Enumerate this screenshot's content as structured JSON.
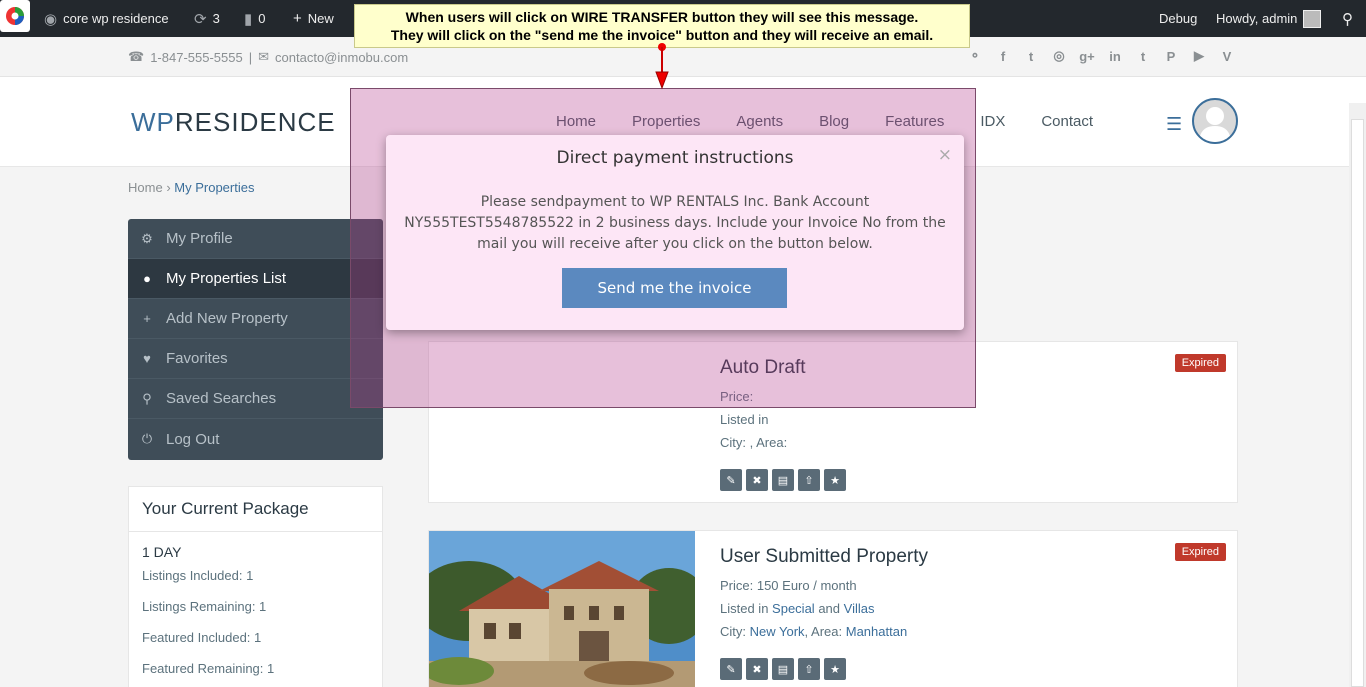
{
  "adminbar": {
    "site_name": "core wp residence",
    "updates_count": "3",
    "comments_count": "0",
    "new_label": "New",
    "debug_label": "Debug",
    "howdy_label": "Howdy, admin"
  },
  "callout": {
    "line1": "When users will click on WIRE TRANSFER button they will see this message.",
    "line2": "They will click on the \"send me the invoice\" button and they will receive an email."
  },
  "topbar": {
    "phone": "1-847-555-5555",
    "separator": "|",
    "email": "contacto@inmobu.com"
  },
  "header": {
    "logo_wp": "WP",
    "logo_rest": "RESIDENCE",
    "nav": [
      "Home",
      "Properties",
      "Agents",
      "Blog",
      "Features",
      "IDX",
      "Contact"
    ]
  },
  "breadcrumb": {
    "home": "Home",
    "sep": "›",
    "current": "My Properties"
  },
  "sidebar": {
    "items": [
      {
        "label": "My Profile",
        "icon": "gear-icon"
      },
      {
        "label": "My Properties List",
        "icon": "map-marker-icon"
      },
      {
        "label": "Add New Property",
        "icon": "plus-icon"
      },
      {
        "label": "Favorites",
        "icon": "heart-icon"
      },
      {
        "label": "Saved Searches",
        "icon": "search-icon"
      },
      {
        "label": "Log Out",
        "icon": "power-icon"
      }
    ]
  },
  "package": {
    "title": "Your Current Package",
    "name": "1 DAY",
    "rows": [
      "Listings Included: 1",
      "Listings Remaining: 1",
      "Featured Included: 1",
      "Featured Remaining: 1"
    ]
  },
  "properties": [
    {
      "title": "Auto Draft",
      "badge": "Expired",
      "price": "Price:",
      "listed": "Listed in",
      "city": "City: , Area:"
    },
    {
      "title": "User Submitted Property",
      "badge": "Expired",
      "price": "Price: 150 Euro / month",
      "listed_prefix": "Listed in",
      "category1": "Special",
      "and": "and",
      "category2": "Villas",
      "city_prefix": "City:",
      "city": "New York",
      "area_prefix": ", Area:",
      "area": "Manhattan"
    }
  ],
  "modal": {
    "title": "Direct payment instructions",
    "close": "×",
    "body": "Please sendpayment to WP RENTALS Inc. Bank Account NY555TEST5548785522 in 2 business days. Include your Invoice No from the mail you will receive after you click on the button below.",
    "button": "Send me the invoice"
  },
  "colors": {
    "accent": "#3b6e9a",
    "badge": "#c0392b",
    "modal_bg": "#fde6f6",
    "callout_bg": "#ffffcc"
  }
}
